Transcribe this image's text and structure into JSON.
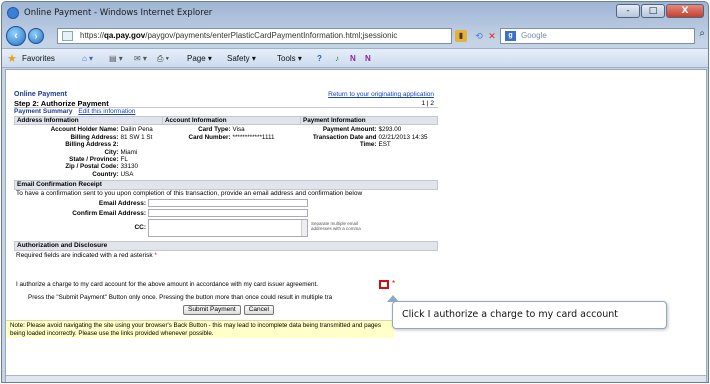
{
  "window": {
    "title": "Online Payment - Windows Internet Explorer",
    "min": "-",
    "max": "□",
    "close": "X"
  },
  "address": {
    "prefix": "https://",
    "host": "qa.pay.gov",
    "path": "/paygov/payments/enterPlasticCardPaymentInformation.html;jsessionic",
    "search_placeholder": "Google"
  },
  "favbar": {
    "favorites": "Favorites",
    "page": "Page ▾",
    "safety": "Safety ▾",
    "tools": "Tools ▾",
    "help": "?"
  },
  "page": {
    "heading": "Online Payment",
    "return_link": "Return to your originating application",
    "step": "Step 2: Authorize Payment",
    "step_count": "1 | 2",
    "summary": "Payment Summary",
    "edit_link": "Edit this information",
    "address_header": "Address Information",
    "account_header": "Account Information",
    "payment_header": "Payment Information",
    "address_rows": [
      {
        "label": "Account Holder Name:",
        "value": "Dailin Pena"
      },
      {
        "label": "Billing Address:",
        "value": "81 SW 1 St"
      },
      {
        "label": "Billing Address 2:",
        "value": ""
      },
      {
        "label": "City:",
        "value": "Miami"
      },
      {
        "label": "State / Province:",
        "value": "FL"
      },
      {
        "label": "Zip / Postal Code:",
        "value": "33130"
      },
      {
        "label": "Country:",
        "value": "USA"
      }
    ],
    "card_type_label": "Card Type:",
    "card_type": "Visa",
    "card_number_label": "Card Number:",
    "card_number": "************1111",
    "amount_label": "Payment Amount:",
    "amount": "$293.00",
    "txn_label": "Transaction Date and Time:",
    "txn_value": "02/21/2013 14:35 EST",
    "email_header": "Email Confirmation Receipt",
    "email_desc": "To have a confirmation sent to you upon completion of this transaction, provide an email address and confirmation below",
    "email_label": "Email Address:",
    "confirm_email_label": "Confirm Email Address:",
    "cc_label": "CC:",
    "cc_note": "Separate multiple email addresses with a comma",
    "auth_header": "Authorization and Disclosure",
    "required_note": "Required fields are indicated with a red asterisk",
    "authorize_text": "I authorize a charge to my card account for the above amount in accordance with my card issuer agreement.",
    "press_text": "Press the \"Submit Payment\" Button only once. Pressing the button more than once could result in multiple tra",
    "submit_label": "Submit Payment",
    "cancel_label": "Cancel",
    "note_text": "Note: Please avoid navigating the site using your browser's Back Button - this may lead to incomplete data being transmitted and pages being loaded incorrectly. Please use the links provided whenever possible."
  },
  "tooltip": {
    "prefix": "Click",
    "text": "I authorize a charge to my card account"
  },
  "colors": {
    "accent": "#1b3a94",
    "required": "#d01010",
    "note_bg": "#ffffc8"
  }
}
